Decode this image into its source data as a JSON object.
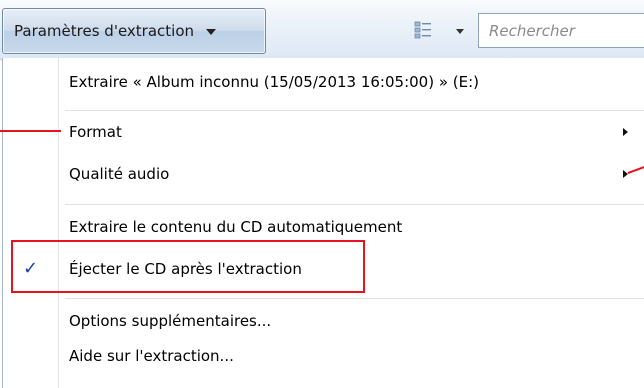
{
  "toolbar": {
    "rip_settings_label": "Paramètres d'extraction",
    "search_placeholder": "Rechercher"
  },
  "menu": {
    "items": [
      {
        "label": "Extraire « Album inconnu (15/05/2013 16:05:00) » (E:)",
        "has_submenu": false,
        "checked": false
      },
      {
        "label": "Format",
        "has_submenu": true,
        "checked": false
      },
      {
        "label": "Qualité audio",
        "has_submenu": true,
        "checked": false
      },
      {
        "label": "Extraire le contenu du CD automatiquement",
        "has_submenu": false,
        "checked": false
      },
      {
        "label": "Éjecter le CD après l'extraction",
        "has_submenu": false,
        "checked": true
      },
      {
        "label": "Options supplémentaires...",
        "has_submenu": false,
        "checked": false
      },
      {
        "label": "Aide sur l'extraction...",
        "has_submenu": false,
        "checked": false
      }
    ],
    "check_glyph": "✓"
  },
  "annotation": {
    "color": "#e5141e"
  }
}
